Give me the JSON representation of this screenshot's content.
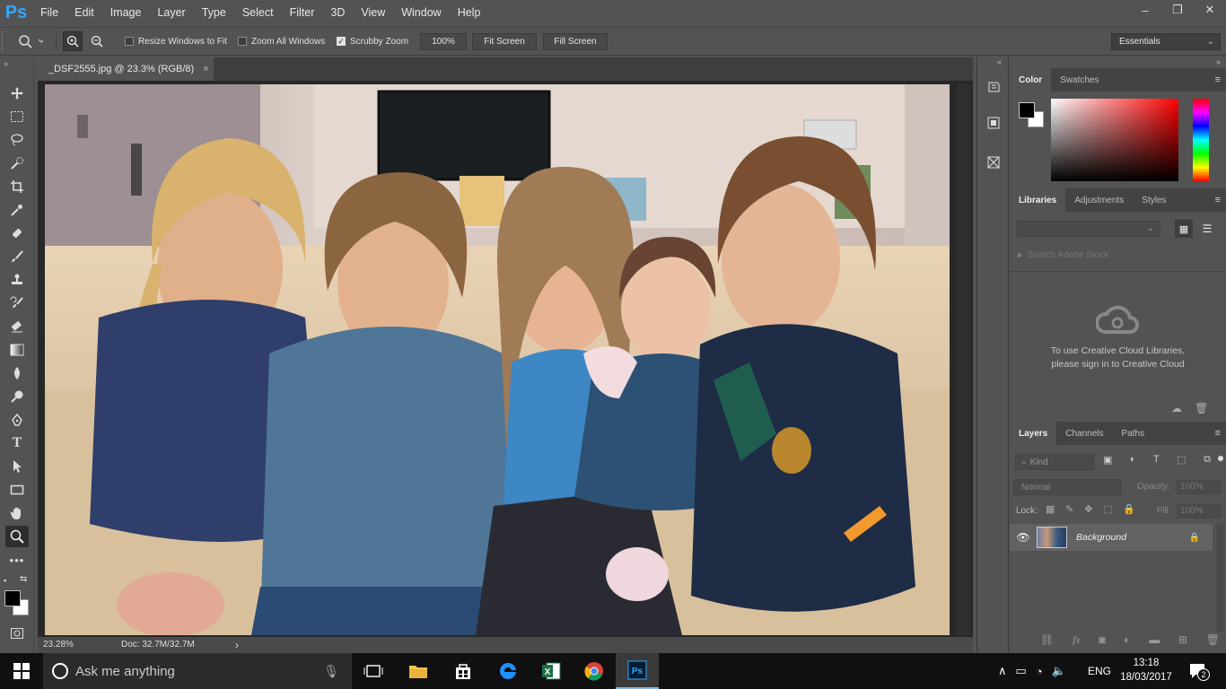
{
  "app": {
    "logo_text": "Ps",
    "menu": [
      "File",
      "Edit",
      "Image",
      "Layer",
      "Type",
      "Select",
      "Filter",
      "3D",
      "View",
      "Window",
      "Help"
    ],
    "window_controls": [
      "–",
      "❐",
      "✕"
    ]
  },
  "options_bar": {
    "resize_windows_label": "Resize Windows to Fit",
    "resize_windows_checked": false,
    "zoom_all_label": "Zoom All Windows",
    "zoom_all_checked": false,
    "scrubby_label": "Scrubby Zoom",
    "scrubby_checked": true,
    "zoom_100": "100%",
    "fit_screen": "Fit Screen",
    "fill_screen": "Fill Screen",
    "workspace": "Essentials"
  },
  "document": {
    "tab_title": "_DSF2555.jpg @ 23.3% (RGB/8)",
    "close_glyph": "×"
  },
  "status": {
    "zoom": "23.28%",
    "doc_size": "Doc: 32.7M/32.7M",
    "arrow": "›"
  },
  "color_panel": {
    "tabs": [
      "Color",
      "Swatches"
    ],
    "foreground": "#000000",
    "background": "#ffffff",
    "hue_color": "#ff0000"
  },
  "libraries_panel": {
    "tabs": [
      "Libraries",
      "Adjustments",
      "Styles"
    ],
    "search_placeholder": "Search Adobe Stock",
    "message_line1": "To use Creative Cloud Libraries,",
    "message_line2": "please sign in to Creative Cloud"
  },
  "layers_panel": {
    "tabs": [
      "Layers",
      "Channels",
      "Paths"
    ],
    "filter_label": "Kind",
    "blend_mode": "Normal",
    "opacity_label": "Opacity:",
    "opacity_value": "100%",
    "lock_label": "Lock:",
    "fill_label": "Fill:",
    "fill_value": "100%",
    "layers": [
      {
        "name": "Background",
        "visible": true,
        "locked": true
      }
    ]
  },
  "taskbar": {
    "search_placeholder": "Ask me anything",
    "language": "ENG",
    "time": "13:18",
    "date": "18/03/2017",
    "notifications": "2"
  },
  "colors": {
    "ui_bg": "#535353",
    "ps_blue": "#31a8ff",
    "taskbar_bg": "#101010"
  }
}
